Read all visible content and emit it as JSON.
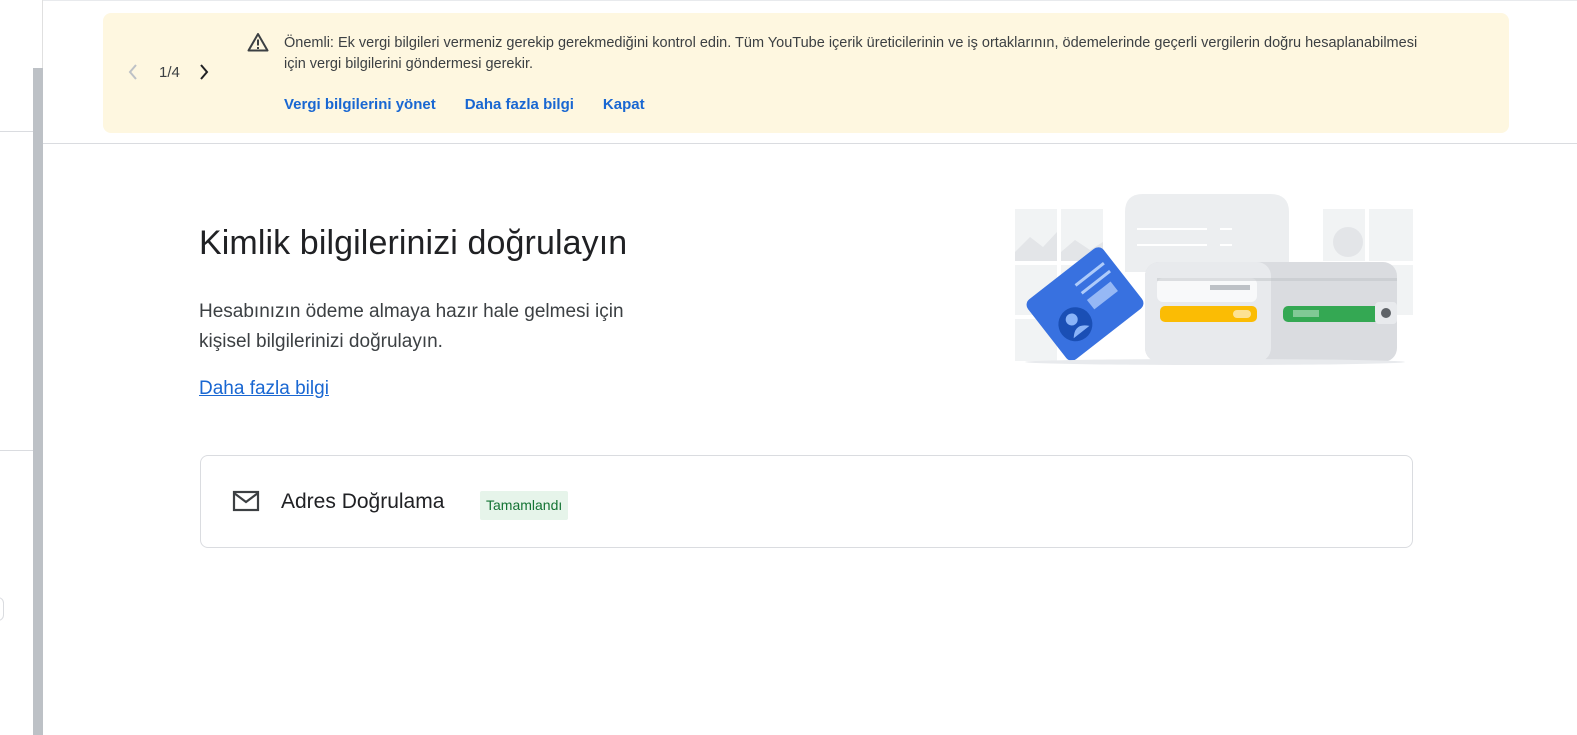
{
  "banner": {
    "pager": {
      "current": "1/4"
    },
    "message": "Önemli: Ek vergi bilgileri vermeniz gerekip gerekmediğini kontrol edin. Tüm YouTube içerik üreticilerinin ve iş ortaklarının, ödemelerinde geçerli vergilerin doğru hesaplanabilmesi için vergi bilgilerini göndermesi gerekir.",
    "actions": {
      "manage_tax": "Vergi bilgilerini yönet",
      "learn_more": "Daha fazla bilgi",
      "close": "Kapat"
    },
    "background_color": "#fef7e0",
    "link_color": "#1967d2"
  },
  "main": {
    "title": "Kimlik bilgilerinizi doğrulayın",
    "description": "Hesabınızın ödeme almaya hazır hale gelmesi için kişisel bilgilerinizi doğrulayın.",
    "learn_more": "Daha fazla bilgi"
  },
  "verification_card": {
    "icon": "mail-icon",
    "title": "Adres Doğrulama",
    "status_badge": "Tamamlandı",
    "badge_bg": "#e6f4ea",
    "badge_color": "#137333"
  },
  "illustration": {
    "icon": "wallet-id-card-illustration"
  }
}
